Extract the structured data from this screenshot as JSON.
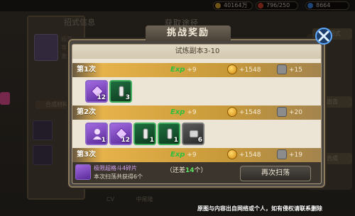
{
  "resources": {
    "gold": "40164万",
    "stamina": "796/250",
    "gems": "8664"
  },
  "background": {
    "left_title": "招式信息",
    "behind_title": "获取途径",
    "left_label_1": "极限",
    "left_label_2": "等级",
    "left_label_3": "激活",
    "synth_material": "合成材料",
    "right_btn_1": "1 招式",
    "right_btn_2": "出击",
    "right_btn_3": "合成",
    "bottom_tab_1": "CV",
    "bottom_tab_2": "中尾隆"
  },
  "modal": {
    "title": "挑战奖励",
    "stage": "试炼副本3-10",
    "rows": [
      {
        "label": "第1次",
        "exp_label": "Exp",
        "exp": "+9",
        "coin": "+1548",
        "bolt": "+15",
        "items": [
          {
            "color": "purple",
            "qty": "12",
            "icon": "crystal-icon"
          },
          {
            "color": "green",
            "qty": "3",
            "icon": "potion-icon"
          }
        ]
      },
      {
        "label": "第2次",
        "exp_label": "Exp",
        "exp": "+9",
        "coin": "+1548",
        "bolt": "+20",
        "items": [
          {
            "color": "purple",
            "qty": "1",
            "icon": "fighter-icon"
          },
          {
            "color": "purple",
            "qty": "12",
            "icon": "crystal-icon"
          },
          {
            "color": "green",
            "qty": "1",
            "icon": "potion-icon"
          },
          {
            "color": "green",
            "qty": "1",
            "icon": "potion-icon"
          },
          {
            "color": "gray",
            "qty": "6",
            "icon": "scroll-icon"
          }
        ]
      },
      {
        "label": "第3次",
        "exp_label": "Exp",
        "exp": "+9",
        "coin": "+1548",
        "bolt": "+19"
      }
    ],
    "bottom": {
      "item_name": "极限超格斗4碎片",
      "obtained": "本次扫荡共获得6个",
      "remain_prefix": "（还差",
      "remain_num": "14",
      "remain_suffix": "个）",
      "sweep_button": "再次扫荡"
    }
  },
  "watermark": "原图与内容出自网络或个人，如有侵权请联系删除"
}
